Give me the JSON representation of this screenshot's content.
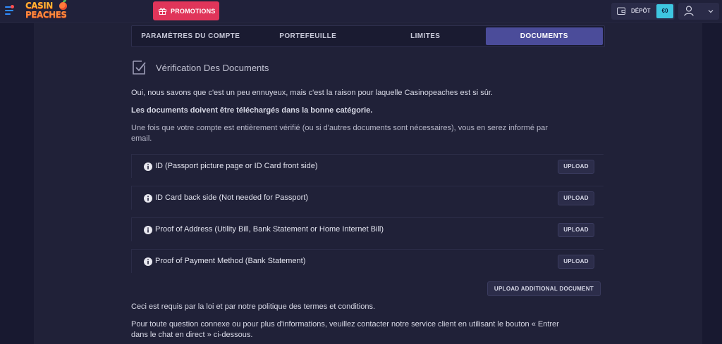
{
  "header": {
    "logo_line1": "CASIN",
    "logo_line2": "PEACHES",
    "promotions_label": "PROMOTIONS",
    "deposit_label": "DÉPÔT",
    "balance": "€0"
  },
  "tabs": [
    {
      "label": "PARAMÈTRES DU COMPTE",
      "active": false
    },
    {
      "label": "PORTEFEUILLE",
      "active": false
    },
    {
      "label": "LIMITES",
      "active": false
    },
    {
      "label": "DOCUMENTS",
      "active": true
    }
  ],
  "section": {
    "title": "Vérification Des Documents",
    "intro": "Oui, nous savons que c'est un peu ennuyeux, mais c'est la raison pour laquelle Casinopeaches est si sûr.",
    "bold_note": "Les documents doivent être téléchargés dans la bonne catégorie.",
    "info_line1": "Une fois que votre compte est entièrement vérifié (ou si d'autres documents sont nécessaires), vous en serez informé par",
    "info_line2": "email."
  },
  "documents": [
    {
      "label": "ID (Passport picture page or ID Card front side)",
      "button": "UPLOAD"
    },
    {
      "label": "ID Card back side (Not needed for Passport)",
      "button": "UPLOAD"
    },
    {
      "label": "Proof of Address (Utility Bill, Bank Statement or Home Internet Bill)",
      "button": "UPLOAD"
    },
    {
      "label": "Proof of Payment Method (Bank Statement)",
      "button": "UPLOAD"
    }
  ],
  "upload_additional": "UPLOAD ADDITIONAL DOCUMENT",
  "footer": {
    "legal": "Ceci est requis par la loi et par notre politique des termes et conditions.",
    "contact_line1": "Pour toute question connexe ou pour plus d'informations, veuillez contacter notre service client en utilisant le bouton « Entrer",
    "contact_line2": "dans le chat en direct » ci-dessous."
  },
  "colors": {
    "background": "#1b1c33",
    "active_tab": "#4b4c9a",
    "promotions": "#e0355a",
    "balance": "#3ec6e0"
  }
}
